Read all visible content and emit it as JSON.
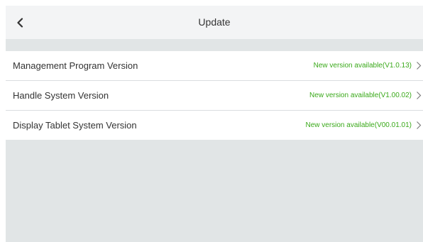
{
  "header": {
    "title": "Update",
    "back_icon": "chevron-left-icon"
  },
  "rows": [
    {
      "label": "Management Program Version",
      "status": "New version available(V1.0.13)",
      "chevron_icon": "chevron-right-icon"
    },
    {
      "label": "Handle System Version",
      "status": "New version available(V1.00.02)",
      "chevron_icon": "chevron-right-icon"
    },
    {
      "label": "Display Tablet System Version",
      "status": "New version available(V00.01.01)",
      "chevron_icon": "chevron-right-icon"
    }
  ],
  "colors": {
    "status_text": "#3aa91a",
    "panel_background": "#e1e5e6",
    "header_background": "#f3f4f5"
  }
}
